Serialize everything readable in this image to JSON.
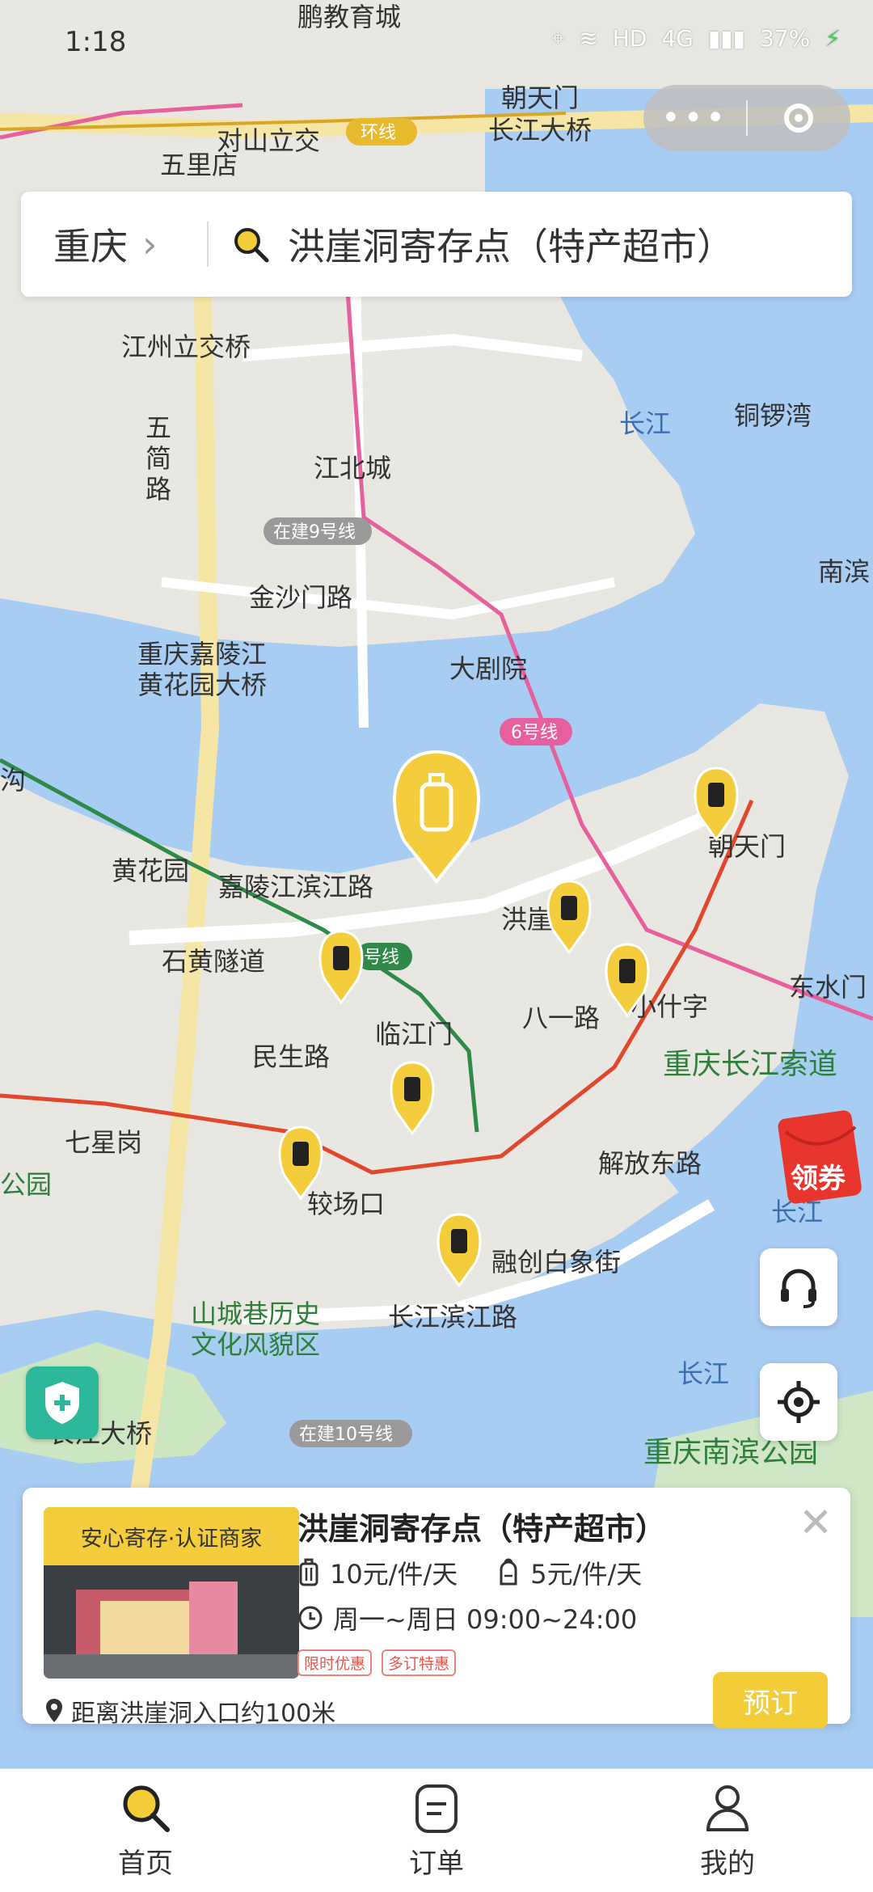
{
  "status": {
    "time": "1:18",
    "network": "HD",
    "signal": "4G",
    "battery": "37%"
  },
  "capsule": {
    "more_icon": "more-dots-icon",
    "close_icon": "target-ring-icon"
  },
  "search": {
    "city": "重庆",
    "query": "洪崖洞寄存点（特产超市）"
  },
  "map_labels": {
    "wuliidian": "五里店",
    "duishan": "对山立交",
    "huanxian": "环线",
    "pengjiao": "鹏教育城",
    "chaotianmen_bridge_1": "朝天门",
    "chaotianmen_bridge_2": "长江大桥",
    "jiangzhou": "江州立交桥",
    "wutong_1": "五",
    "wutong_2": "简",
    "wutong_3": "路",
    "jiangbeicheng": "江北城",
    "line9": "在建9号线",
    "jinshamen": "金沙门路",
    "jialing_bridge_1": "重庆嘉陵江",
    "jialing_bridge_2": "黄花园大桥",
    "dajuyuan": "大剧院",
    "line6": "6号线",
    "changjiang_top": "长江",
    "tongluowan": "铜锣湾",
    "nanbin": "南滨",
    "huanghuayuan": "黄花园",
    "binjiang": "嘉陵江滨江路",
    "hongya": "洪崖",
    "chaotianmen": "朝天门",
    "xiaoshizi": "小什字",
    "line1": "号线",
    "linjiangmen": "临江门",
    "minsheng": "民生路",
    "shihuang": "石黄隧道",
    "qixinggang": "七星岗",
    "jiaochangkou": "较场口",
    "baixiang": "融创白象街",
    "shancheng_1": "山城巷历史",
    "shancheng_2": "文化风貌区",
    "changbin": "长江滨江路",
    "line10": "在建10号线",
    "changjiang_mid": "长江",
    "suodao": "重庆长江索道",
    "nanbin_park": "重庆南滨公园",
    "changjiang_bridge": "长江大桥",
    "park_left": "公园",
    "bayi": "八一路",
    "jiefang": "解放东路",
    "dongshui": "东水门",
    "changjiang_right": "长江",
    "kou": "沟"
  },
  "coupon": {
    "label": "领券"
  },
  "card": {
    "banner": "安心寄存·认证商家",
    "title": "洪崖洞寄存点（特产超市）",
    "price_large": "10元/件/天",
    "price_small": "5元/件/天",
    "hours": "周一~周日 09:00~24:00",
    "tags": [
      "限时优惠",
      "多订特惠"
    ],
    "distance": "距离洪崖洞入口约100米",
    "book": "预订"
  },
  "nav": [
    {
      "label": "首页",
      "icon": "search-icon",
      "active": true
    },
    {
      "label": "订单",
      "icon": "order-icon",
      "active": false
    },
    {
      "label": "我的",
      "icon": "profile-icon",
      "active": false
    }
  ],
  "colors": {
    "accent": "#f2cd38",
    "water": "#a8cdf2",
    "land": "#e9e7e2",
    "road": "#f6e6a6"
  }
}
